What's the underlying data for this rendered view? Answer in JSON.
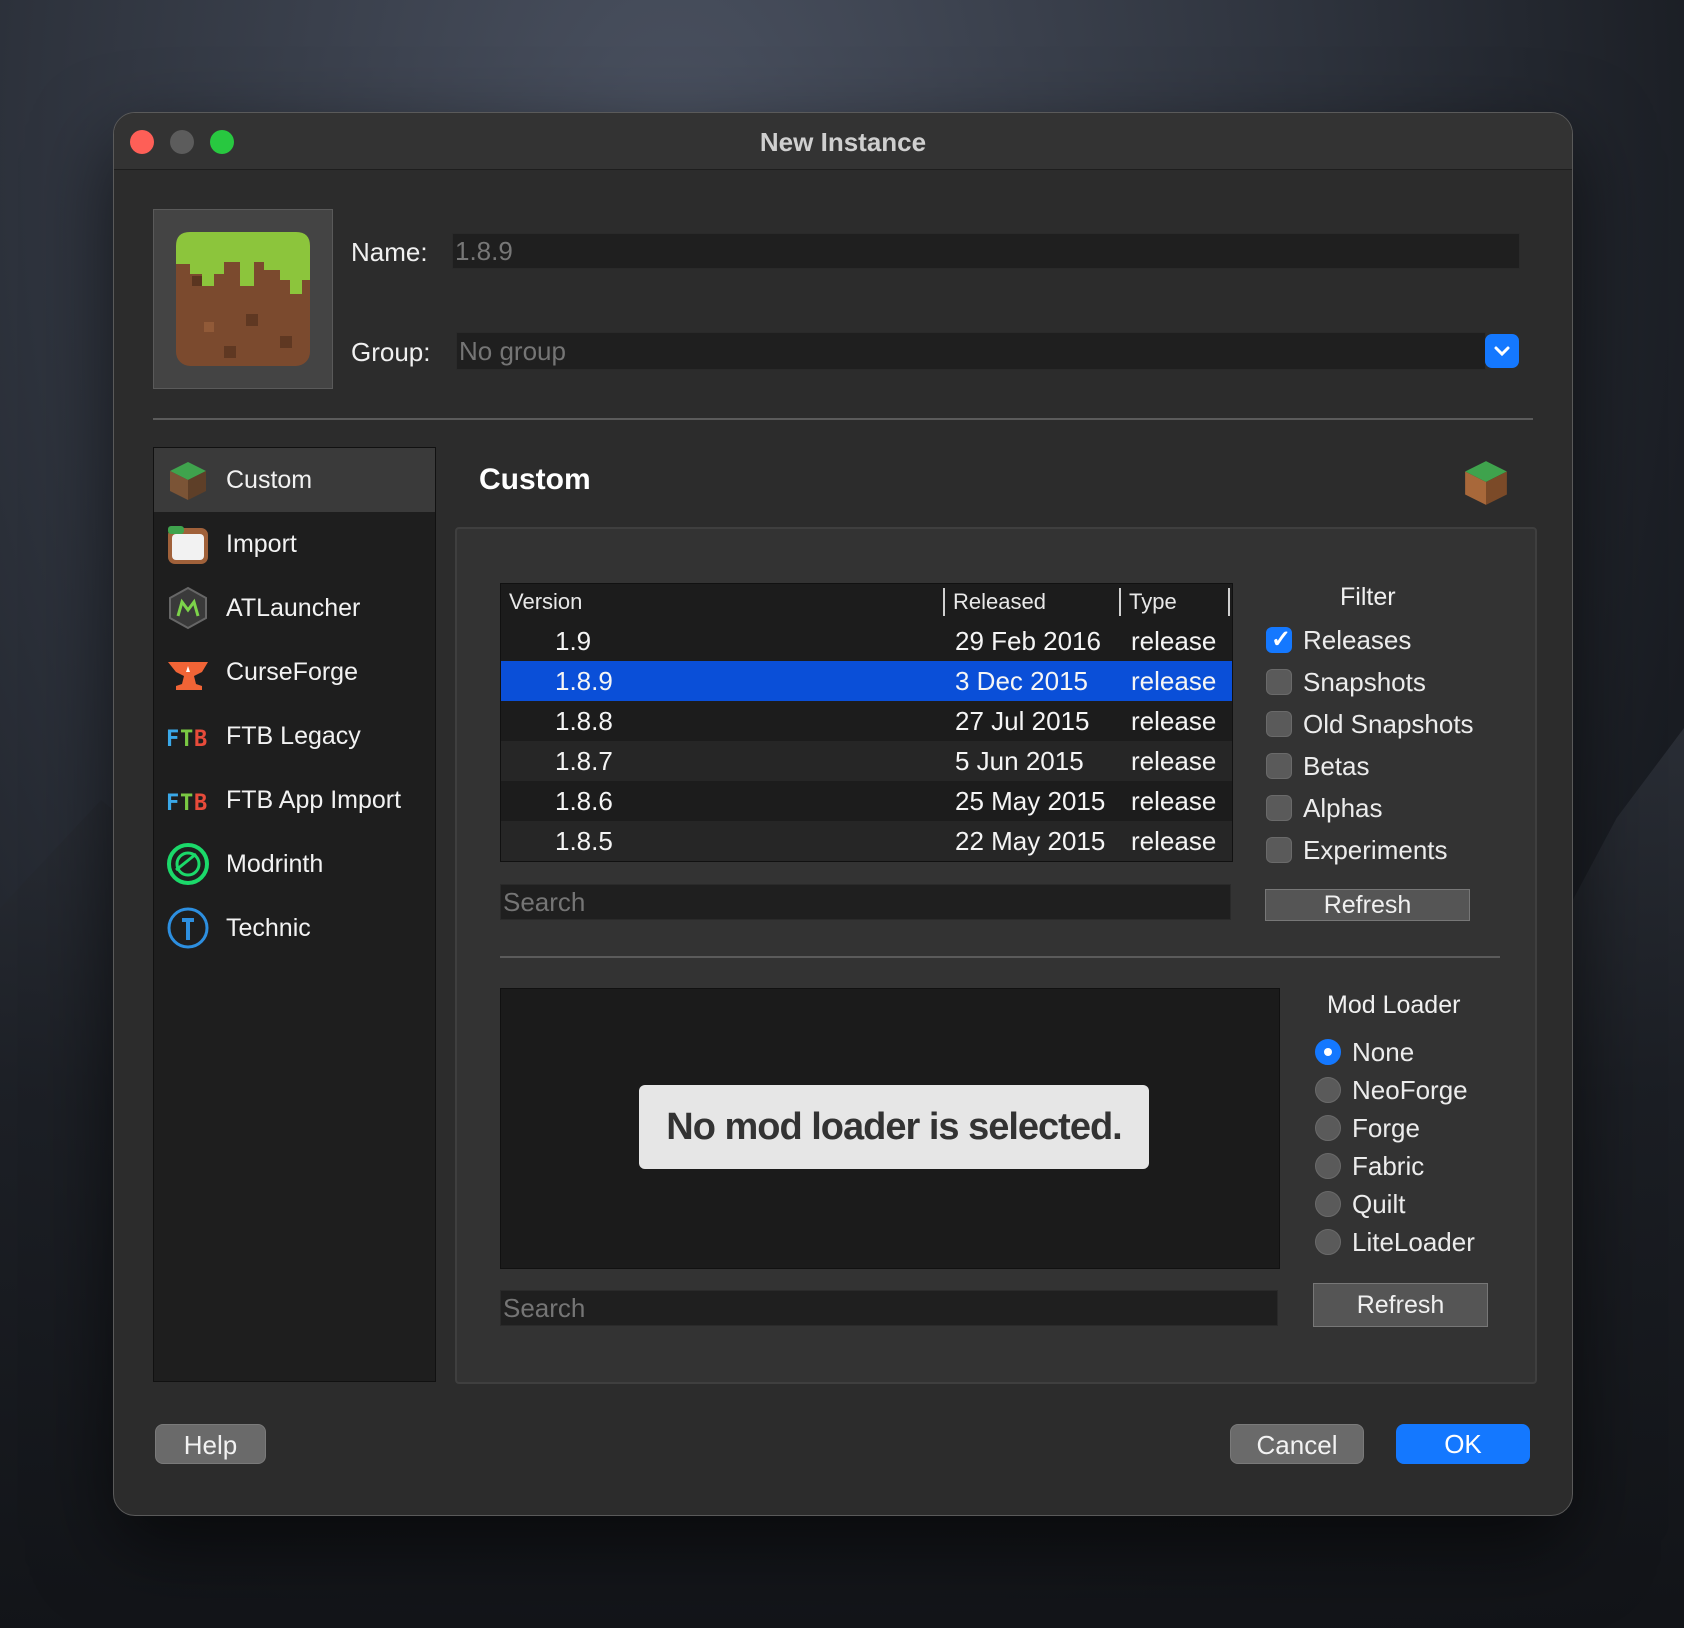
{
  "window": {
    "title": "New Instance"
  },
  "form": {
    "name_label": "Name:",
    "name_value": "1.8.9",
    "group_label": "Group:",
    "group_placeholder": "No group"
  },
  "sidebar": {
    "items": [
      {
        "label": "Custom",
        "icon": "grass-block-icon",
        "active": true
      },
      {
        "label": "Import",
        "icon": "folder-icon"
      },
      {
        "label": "ATLauncher",
        "icon": "atlauncher-icon"
      },
      {
        "label": "CurseForge",
        "icon": "curseforge-anvil-icon"
      },
      {
        "label": "FTB Legacy",
        "icon": "ftb-icon"
      },
      {
        "label": "FTB App Import",
        "icon": "ftb-icon"
      },
      {
        "label": "Modrinth",
        "icon": "modrinth-icon"
      },
      {
        "label": "Technic",
        "icon": "technic-icon"
      }
    ]
  },
  "main": {
    "heading": "Custom"
  },
  "versions": {
    "columns": [
      "Version",
      "Released",
      "Type"
    ],
    "rows": [
      {
        "version": "1.9",
        "released": "29 Feb 2016",
        "type": "release"
      },
      {
        "version": "1.8.9",
        "released": "3 Dec 2015",
        "type": "release",
        "selected": true
      },
      {
        "version": "1.8.8",
        "released": "27 Jul 2015",
        "type": "release"
      },
      {
        "version": "1.8.7",
        "released": "5 Jun 2015",
        "type": "release"
      },
      {
        "version": "1.8.6",
        "released": "25 May 2015",
        "type": "release"
      },
      {
        "version": "1.8.5",
        "released": "22 May 2015",
        "type": "release"
      }
    ],
    "search_placeholder": "Search"
  },
  "filter": {
    "title": "Filter",
    "options": [
      {
        "label": "Releases",
        "checked": true
      },
      {
        "label": "Snapshots",
        "checked": false
      },
      {
        "label": "Old Snapshots",
        "checked": false
      },
      {
        "label": "Betas",
        "checked": false
      },
      {
        "label": "Alphas",
        "checked": false
      },
      {
        "label": "Experiments",
        "checked": false
      }
    ],
    "refresh_label": "Refresh"
  },
  "mod_loader": {
    "title": "Mod Loader",
    "notice": "No mod loader is selected.",
    "options": [
      {
        "label": "None",
        "selected": true
      },
      {
        "label": "NeoForge",
        "selected": false
      },
      {
        "label": "Forge",
        "selected": false
      },
      {
        "label": "Fabric",
        "selected": false
      },
      {
        "label": "Quilt",
        "selected": false
      },
      {
        "label": "LiteLoader",
        "selected": false
      }
    ],
    "search_placeholder": "Search",
    "refresh_label": "Refresh"
  },
  "footer": {
    "help_label": "Help",
    "cancel_label": "Cancel",
    "ok_label": "OK"
  },
  "colors": {
    "accent": "#1478ff",
    "selection": "#0a4fd8",
    "window_bg": "#2c2c2c"
  }
}
